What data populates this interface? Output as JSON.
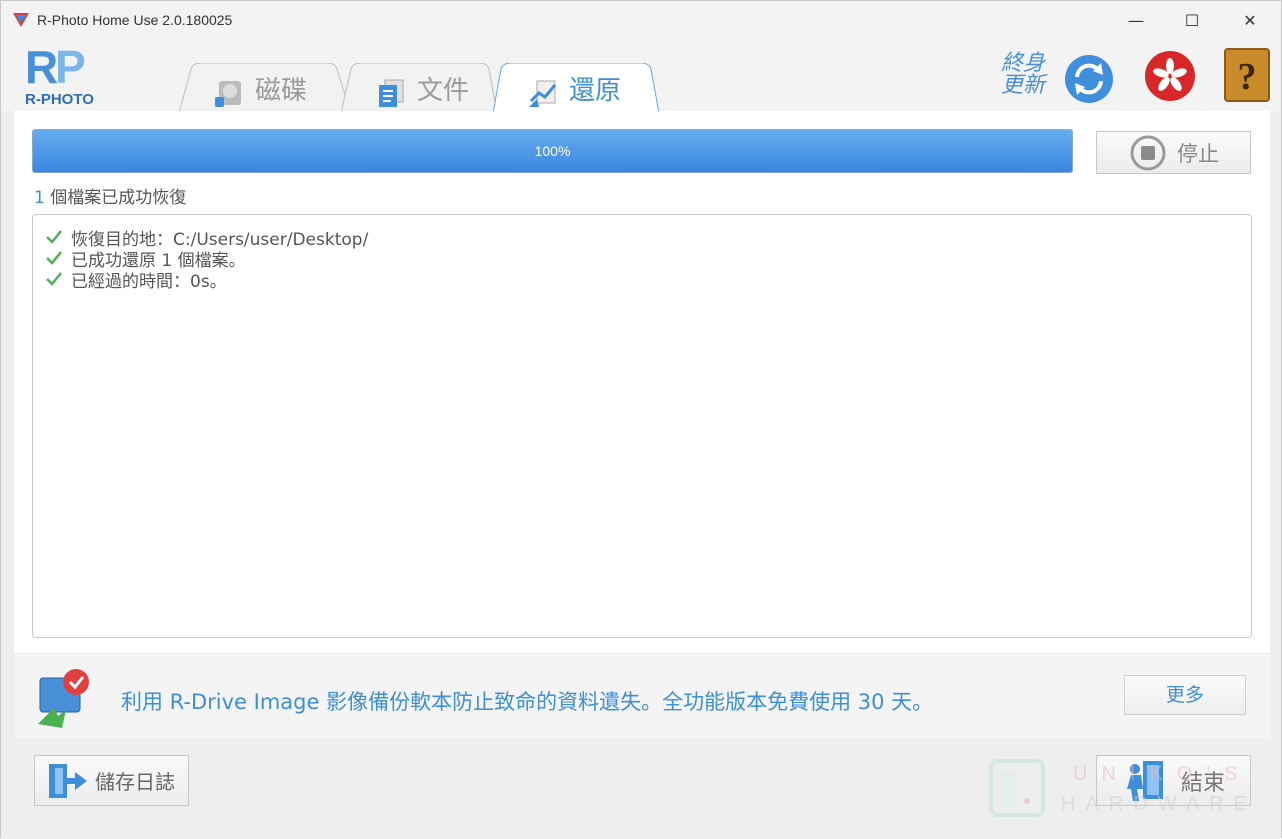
{
  "window": {
    "title": "R-Photo Home Use 2.0.180025",
    "controls": {
      "minimize": "—",
      "maximize": "☐",
      "close": "✕"
    }
  },
  "header": {
    "logo_text": "R-PHOTO",
    "tabs": [
      {
        "label": "磁碟",
        "icon": "disk-icon",
        "active": false
      },
      {
        "label": "文件",
        "icon": "documents-icon",
        "active": false
      },
      {
        "label": "還原",
        "icon": "restore-icon",
        "active": true
      }
    ],
    "lifetime_update": {
      "line1": "終身",
      "line2": "更新"
    }
  },
  "progress": {
    "percent": 100,
    "label": "100%"
  },
  "stop_button": {
    "label": "停止"
  },
  "status": {
    "count": "1",
    "text": " 個檔案已成功恢復"
  },
  "log": [
    {
      "text": "恢復目的地：C:/Users/user/Desktop/",
      "icon": "check-icon"
    },
    {
      "text": "已成功還原 1 個檔案。",
      "icon": "check-icon"
    },
    {
      "text": "已經過的時間：0s。",
      "icon": "check-icon"
    }
  ],
  "promo": {
    "text": "利用 R-Drive Image 影像備份軟本防止致命的資料遺失。全功能版本免費使用 30 天。",
    "more_label": "更多"
  },
  "bottom": {
    "save_log_label": "儲存日誌",
    "finish_label": "結束"
  },
  "watermark": {
    "top": "UNIKO'S",
    "bottom": "HARDWARE"
  },
  "colors": {
    "accent": "#3c8fd8",
    "progress": "#3a87e0",
    "check": "#4caf50"
  }
}
